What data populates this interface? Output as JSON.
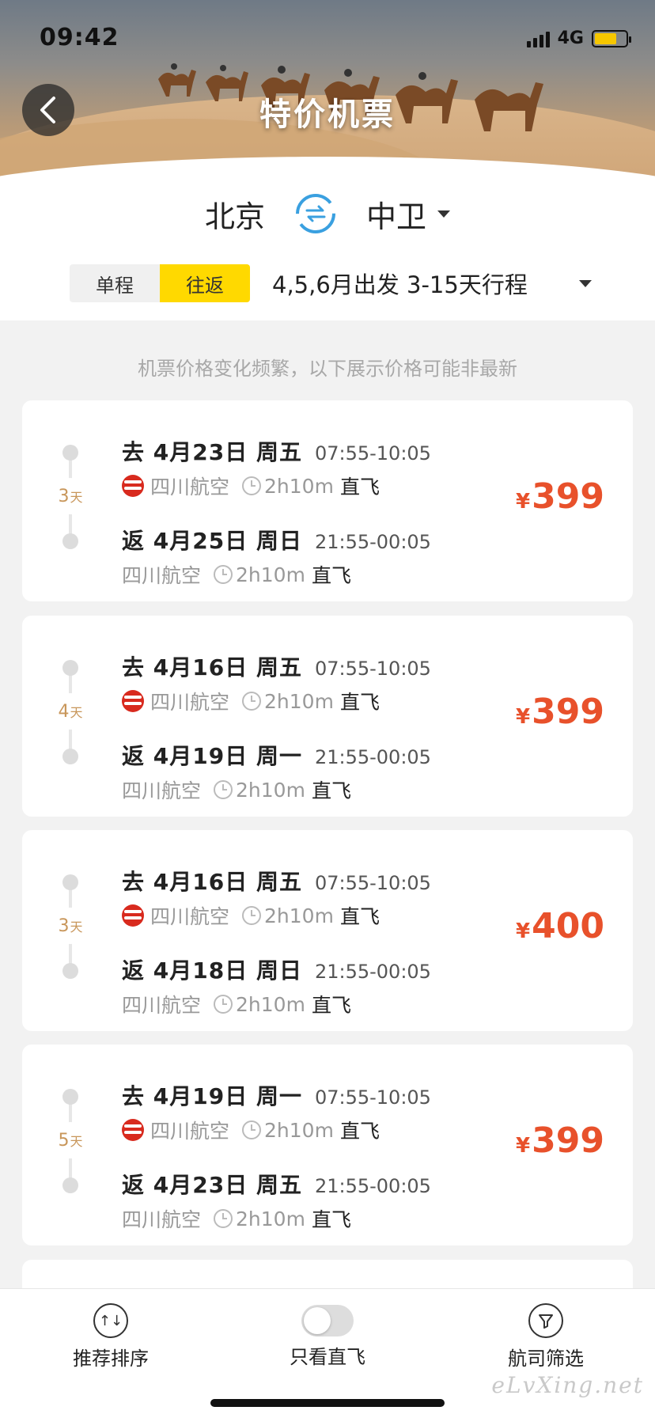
{
  "status": {
    "time": "09:42",
    "network": "4G"
  },
  "header": {
    "title": "特价机票"
  },
  "route": {
    "from": "北京",
    "to": "中卫"
  },
  "trip": {
    "one_way": "单程",
    "round_trip": "往返",
    "selected": "往返",
    "depart_filter": "4,5,6月出发 3-15天行程"
  },
  "notice": "机票价格变化频繁，以下展示价格可能非最新",
  "cards": [
    {
      "days": "3",
      "days_unit": "天",
      "out": {
        "date": "去 4月23日 周五",
        "time": "07:55-10:05",
        "airline": "四川航空",
        "duration": "2h10m",
        "type": "直飞"
      },
      "ret": {
        "date": "返 4月25日 周日",
        "time": "21:55-00:05",
        "airline": "四川航空",
        "duration": "2h10m",
        "type": "直飞"
      },
      "currency": "¥",
      "price": "399"
    },
    {
      "days": "4",
      "days_unit": "天",
      "out": {
        "date": "去 4月16日 周五",
        "time": "07:55-10:05",
        "airline": "四川航空",
        "duration": "2h10m",
        "type": "直飞"
      },
      "ret": {
        "date": "返 4月19日 周一",
        "time": "21:55-00:05",
        "airline": "四川航空",
        "duration": "2h10m",
        "type": "直飞"
      },
      "currency": "¥",
      "price": "399"
    },
    {
      "days": "3",
      "days_unit": "天",
      "out": {
        "date": "去 4月16日 周五",
        "time": "07:55-10:05",
        "airline": "四川航空",
        "duration": "2h10m",
        "type": "直飞"
      },
      "ret": {
        "date": "返 4月18日 周日",
        "time": "21:55-00:05",
        "airline": "四川航空",
        "duration": "2h10m",
        "type": "直飞"
      },
      "currency": "¥",
      "price": "400"
    },
    {
      "days": "5",
      "days_unit": "天",
      "out": {
        "date": "去 4月19日 周一",
        "time": "07:55-10:05",
        "airline": "四川航空",
        "duration": "2h10m",
        "type": "直飞"
      },
      "ret": {
        "date": "返 4月23日 周五",
        "time": "21:55-00:05",
        "airline": "四川航空",
        "duration": "2h10m",
        "type": "直飞"
      },
      "currency": "¥",
      "price": "399"
    }
  ],
  "toolbar": {
    "sort": "推荐排序",
    "direct_only": "只看直飞",
    "airline_filter": "航司筛选"
  },
  "watermark": "eLvXing.net",
  "colors": {
    "accent": "#ffd900",
    "price": "#e8512b",
    "swap": "#3aa0e0"
  }
}
